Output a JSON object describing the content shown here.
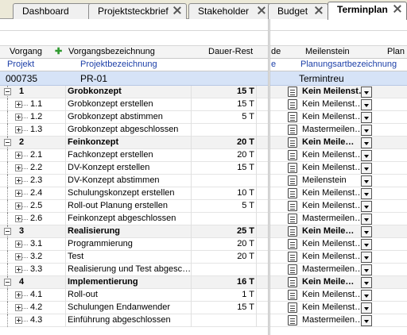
{
  "tabs": [
    {
      "label": "Dashboard",
      "active": false
    },
    {
      "label": "Projektsteckbrief",
      "active": false
    },
    {
      "label": "Stakeholder",
      "active": false
    },
    {
      "label": "Budget",
      "active": false
    },
    {
      "label": "Terminplan",
      "active": true
    }
  ],
  "columns": {
    "vorgang": "Vorgang",
    "add_icon": "plus-icon",
    "vorgangsbezeichnung": "Vorgangsbezeichnung",
    "dauer_rest": "Dauer-Rest",
    "de": "de",
    "meilenstein": "Meilenstein",
    "plan": "Plan"
  },
  "subheader": {
    "projekt": "Projekt",
    "projektbezeichnung": "Projektbezeichnung",
    "e": "e",
    "planungsart": "Planungsartbezeichnung"
  },
  "project": {
    "id": "000735",
    "name": "PR-01",
    "planungsart": "Termintreu"
  },
  "rows": [
    {
      "id": "1",
      "name": "Grobkonzept",
      "dur": "15 T",
      "ms": "Kein Meilenst…",
      "group": true
    },
    {
      "id": "1.1",
      "name": "Grobkonzept erstellen",
      "dur": "15 T",
      "ms": "Kein Meilenst…",
      "group": false
    },
    {
      "id": "1.2",
      "name": "Grobkonzept abstimmen",
      "dur": "5 T",
      "ms": "Kein Meilenst…",
      "group": false
    },
    {
      "id": "1.3",
      "name": "Grobkonzept abgeschlossen",
      "dur": "",
      "ms": "Mastermeilen…",
      "group": false
    },
    {
      "id": "2",
      "name": "Feinkonzept",
      "dur": "20 T",
      "ms": "Kein Meile…",
      "group": true
    },
    {
      "id": "2.1",
      "name": "Fachkonzept erstellen",
      "dur": "20 T",
      "ms": "Kein Meilenst…",
      "group": false
    },
    {
      "id": "2.2",
      "name": "DV-Konzept erstellen",
      "dur": "15 T",
      "ms": "Kein Meilenst…",
      "group": false
    },
    {
      "id": "2.3",
      "name": "DV-Konzept abstimmen",
      "dur": "",
      "ms": "Meilenstein",
      "group": false
    },
    {
      "id": "2.4",
      "name": "Schulungskonzept erstellen",
      "dur": "10 T",
      "ms": "Kein Meilenst…",
      "group": false
    },
    {
      "id": "2.5",
      "name": "Roll-out Planung erstellen",
      "dur": "5 T",
      "ms": "Kein Meilenst…",
      "group": false
    },
    {
      "id": "2.6",
      "name": "Feinkonzept abgeschlossen",
      "dur": "",
      "ms": "Mastermeilen…",
      "group": false
    },
    {
      "id": "3",
      "name": "Realisierung",
      "dur": "25 T",
      "ms": "Kein Meile…",
      "group": true
    },
    {
      "id": "3.1",
      "name": "Programmierung",
      "dur": "20 T",
      "ms": "Kein Meilenst…",
      "group": false
    },
    {
      "id": "3.2",
      "name": "Test",
      "dur": "20 T",
      "ms": "Kein Meilenst…",
      "group": false
    },
    {
      "id": "3.3",
      "name": "Realisierung und Test abgesc…",
      "dur": "",
      "ms": "Mastermeilen…",
      "group": false
    },
    {
      "id": "4",
      "name": "Implementierung",
      "dur": "16 T",
      "ms": "Kein Meile…",
      "group": true
    },
    {
      "id": "4.1",
      "name": "Roll-out",
      "dur": "1 T",
      "ms": "Kein Meilenst…",
      "group": false
    },
    {
      "id": "4.2",
      "name": "Schulungen Endanwender",
      "dur": "15 T",
      "ms": "Kein Meilenst…",
      "group": false
    },
    {
      "id": "4.3",
      "name": "Einführung abgeschlossen",
      "dur": "",
      "ms": "Mastermeilen…",
      "group": false
    }
  ]
}
